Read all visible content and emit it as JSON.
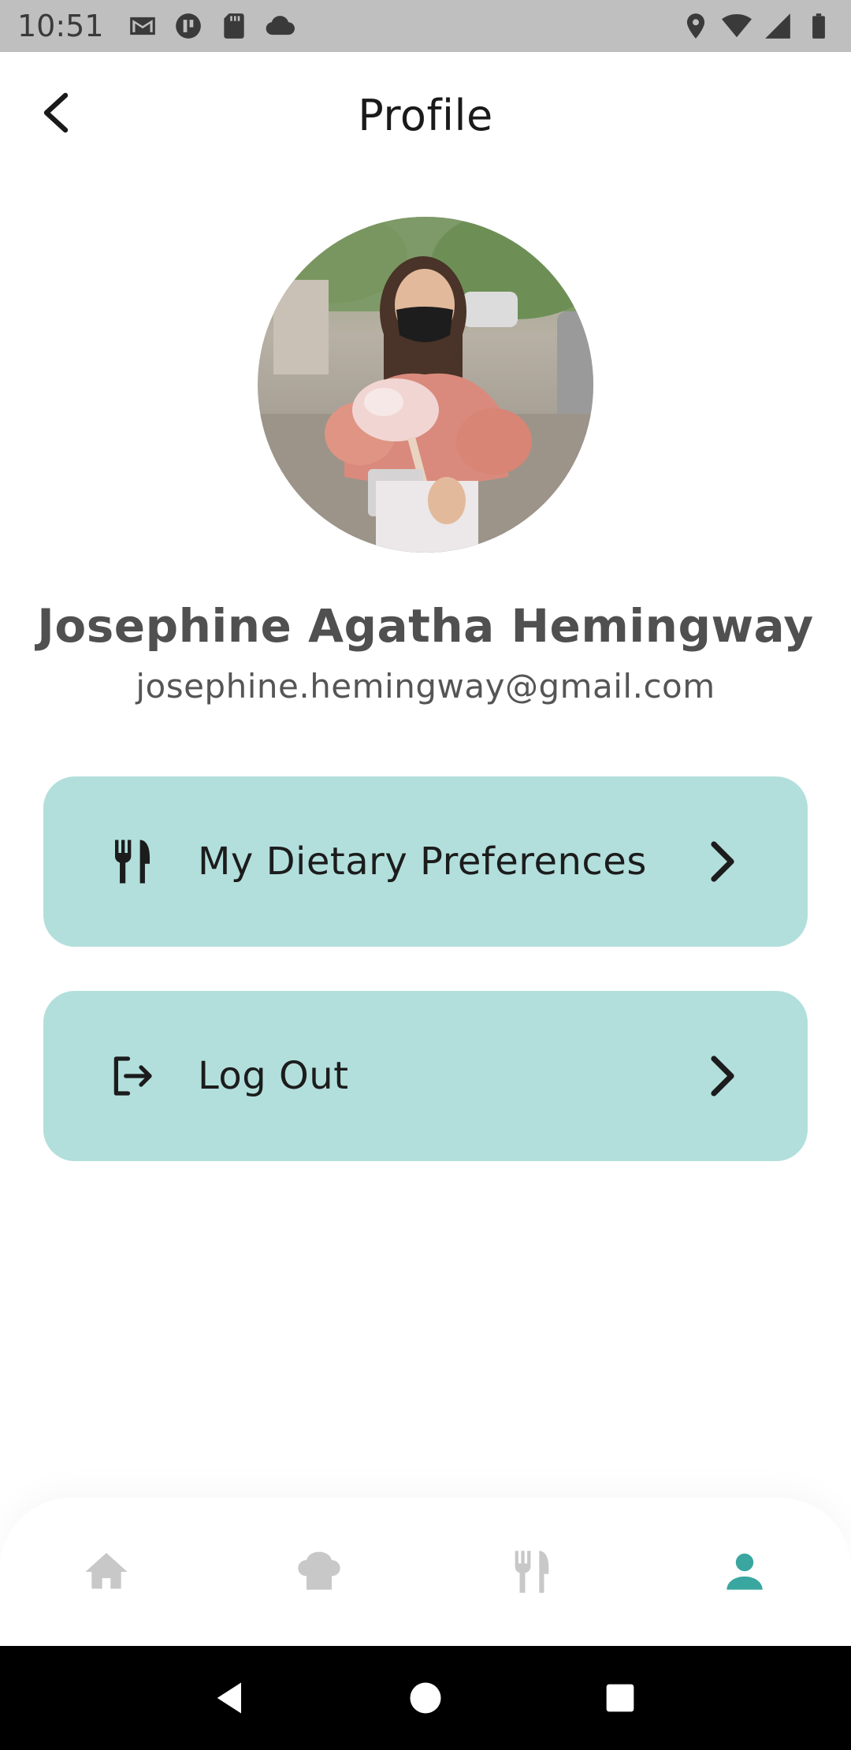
{
  "status_bar": {
    "time": "10:51",
    "left_icons": [
      "gmail-icon",
      "app-notification-icon",
      "sd-card-icon",
      "cloud-icon"
    ],
    "right_icons": [
      "location-icon",
      "wifi-icon",
      "signal-icon",
      "battery-icon"
    ]
  },
  "header": {
    "title": "Profile",
    "back_icon": "chevron-left-icon"
  },
  "profile": {
    "name": "Josephine Agatha Hemingway",
    "email": "josephine.hemingway@gmail.com"
  },
  "menu": [
    {
      "label": "My Dietary Preferences",
      "icon": "fork-knife-icon"
    },
    {
      "label": "Log Out",
      "icon": "logout-icon"
    }
  ],
  "bottom_nav": {
    "items": [
      {
        "icon": "home-icon",
        "active": false
      },
      {
        "icon": "chef-hat-icon",
        "active": false
      },
      {
        "icon": "fork-knife-icon",
        "active": false
      },
      {
        "icon": "person-icon",
        "active": true
      }
    ]
  },
  "system_nav": [
    "back-triangle-icon",
    "home-circle-icon",
    "recents-square-icon"
  ],
  "colors": {
    "card_bg": "#b2dfdc",
    "accent": "#3aa6a0",
    "nav_inactive": "#c8c8c8",
    "status_bar_bg": "#bfbfbf"
  }
}
